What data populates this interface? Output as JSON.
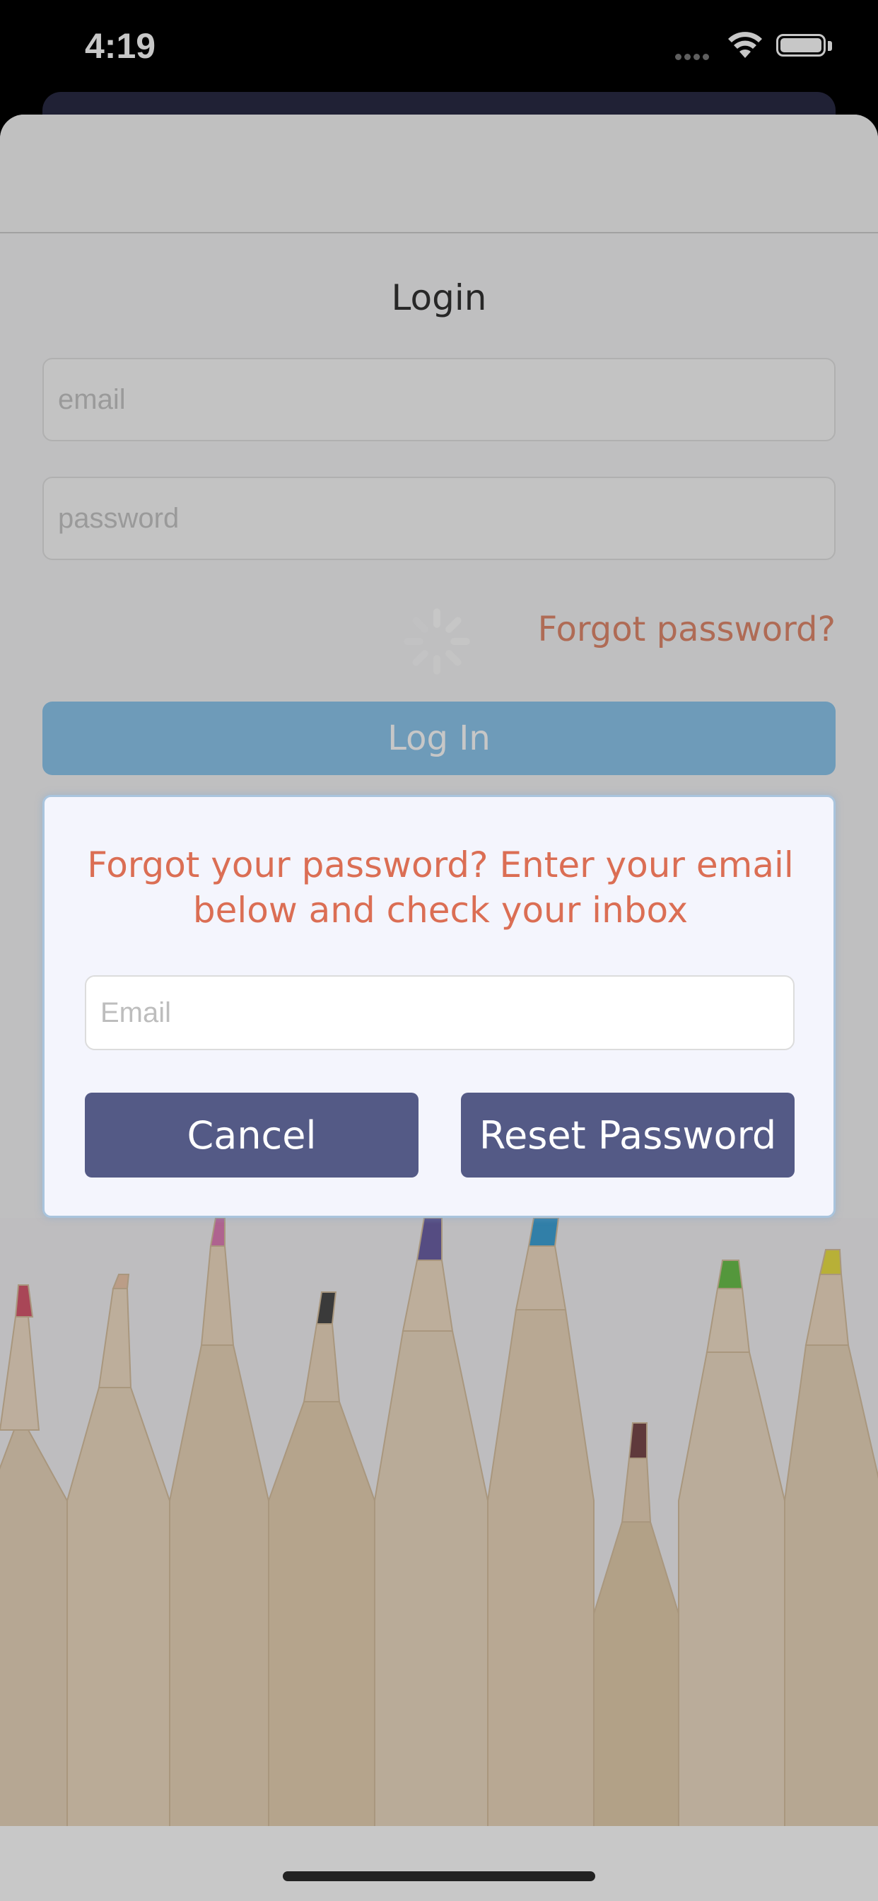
{
  "status_bar": {
    "time": "4:19"
  },
  "login": {
    "title": "Login",
    "email_placeholder": "email",
    "password_placeholder": "password",
    "forgot_link": "Forgot password?",
    "login_button": "Log In"
  },
  "modal": {
    "message": "Forgot your password? Enter  your email below and check your inbox",
    "email_placeholder": "Email",
    "cancel_label": "Cancel",
    "reset_label": "Reset Password"
  },
  "colors": {
    "accent_text": "#db6e54",
    "login_button": "#8ec7ee",
    "modal_buttons": "#545a86",
    "modal_background": "#f4f5fd"
  }
}
